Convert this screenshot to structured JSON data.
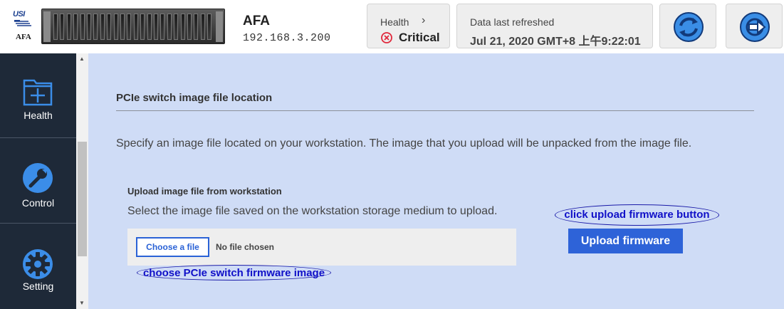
{
  "header": {
    "logo": {
      "brand": "USI",
      "label": "AFA"
    },
    "system_name": "AFA",
    "system_ip": "192.168.3.200",
    "health": {
      "label": "Health",
      "chevron": "›",
      "status": "Critical",
      "status_color": "#e0283c"
    },
    "refresh": {
      "label": "Data last refreshed",
      "value": "Jul 21, 2020 GMT+8 上午9:22:01"
    },
    "buttons": {
      "sync_icon": "sync-icon",
      "logout_icon": "logout-icon"
    }
  },
  "sidebar": {
    "items": [
      {
        "label": "Health",
        "icon": "health-folder-icon"
      },
      {
        "label": "Control",
        "icon": "wrench-icon"
      },
      {
        "label": "Setting",
        "icon": "gear-icon"
      }
    ],
    "bg_color": "#1e2938",
    "icon_color": "#3b8de8"
  },
  "main": {
    "section_title": "PCIe switch image file location",
    "description": "Specify an image file located on your workstation. The image that you upload will be unpacked from the image file.",
    "upload": {
      "title": "Upload image file from workstation",
      "description": "Select the image file saved on the workstation storage medium to upload.",
      "choose_label": "Choose a file",
      "file_status": "No file chosen",
      "upload_button": "Upload firmware"
    },
    "annotations": {
      "upload_callout": "click upload firmware button",
      "choose_callout": "choose PCIe switch firmware image"
    },
    "accent_color": "#2e63d8",
    "bg_color": "#cfdcf6"
  }
}
